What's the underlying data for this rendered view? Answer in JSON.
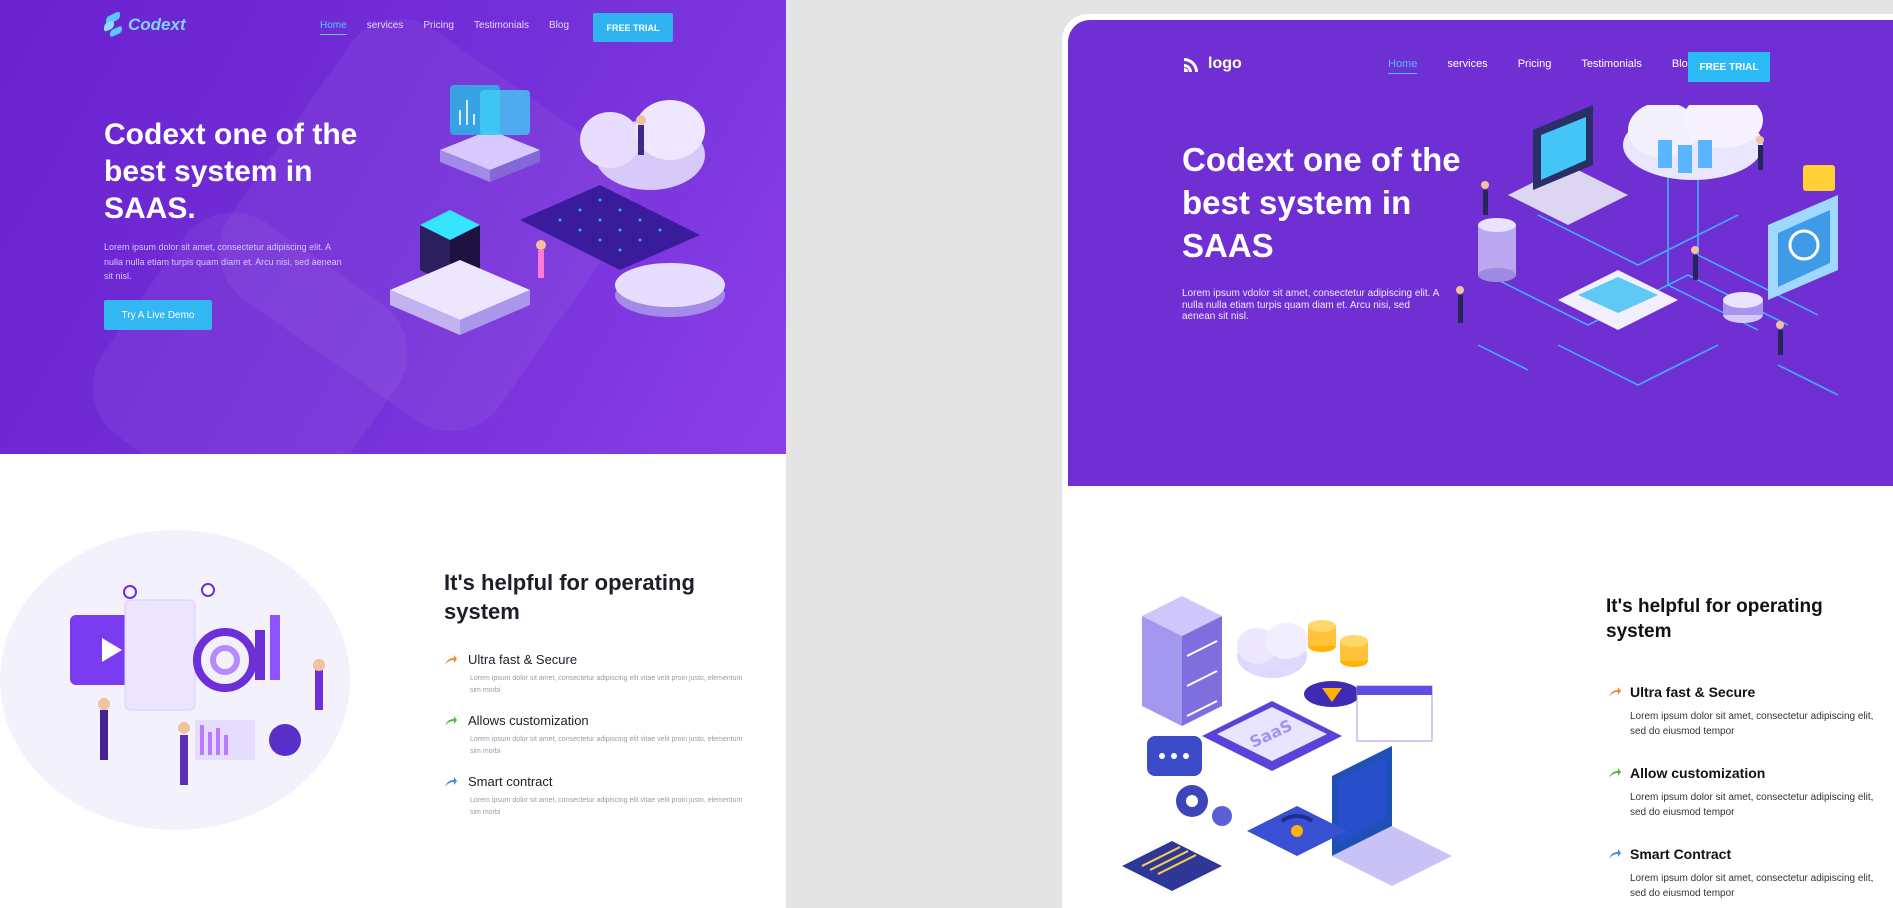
{
  "left_mock": {
    "logo": "Codext",
    "nav": [
      "Home",
      "services",
      "Pricing",
      "Testimonials",
      "Blog"
    ],
    "cta_label": "FREE TRIAL",
    "hero_title": "Codext one of the best system in SAAS.",
    "hero_desc": "Lorem ipsum dolor sit amet, consectetur adipiscing elit. A nulla nulla etiam turpis quam diam et. Arcu nisi, sed aenean sit nisl.",
    "demo_label": "Try A Live Demo",
    "feature_heading": "It's helpful for operating system",
    "features": [
      {
        "title": "Ultra fast & Secure",
        "desc": "Lorem ipsum dolor sit amet, consectetur adipiscing elit vitae velit proin justo, elementum sim morbi",
        "color": "#f08a2e"
      },
      {
        "title": "Allows customization",
        "desc": "Lorem ipsum dolor sit amet, consectetur adipiscing elit vitae velit proin justo, elementum sim morbi",
        "color": "#4cbb3a"
      },
      {
        "title": "Smart contract",
        "desc": "Lorem ipsum dolor sit amet, consectetur adipiscing elit vitae velit proin justo, elementum sim morbi",
        "color": "#3f8fe0"
      }
    ]
  },
  "right_mock": {
    "logo": "logo",
    "nav": [
      "Home",
      "services",
      "Pricing",
      "Testimonials",
      "Blog"
    ],
    "cta_label": "FREE TRIAL",
    "hero_title": "Codext one of the best system in SAAS",
    "hero_desc": "Lorem ipsum vdolor sit amet, consectetur adipiscing elit. A nulla nulla etiam turpis quam diam et. Arcu nisi, sed aenean sit nisl.",
    "feature_heading": "It's helpful for operating system",
    "illustration_label": "SaaS",
    "features": [
      {
        "title": "Ultra fast & Secure",
        "desc": "Lorem ipsum dolor sit amet, consectetur adipiscing elit, sed do eiusmod tempor",
        "color": "#f08a2e"
      },
      {
        "title": "Allow customization",
        "desc": "Lorem ipsum dolor sit amet, consectetur adipiscing elit, sed do eiusmod tempor",
        "color": "#4cbb3a"
      },
      {
        "title": "Smart Contract",
        "desc": "Lorem ipsum dolor sit amet, consectetur adipiscing elit, sed do eiusmod tempor",
        "color": "#3f8fe0"
      }
    ]
  }
}
